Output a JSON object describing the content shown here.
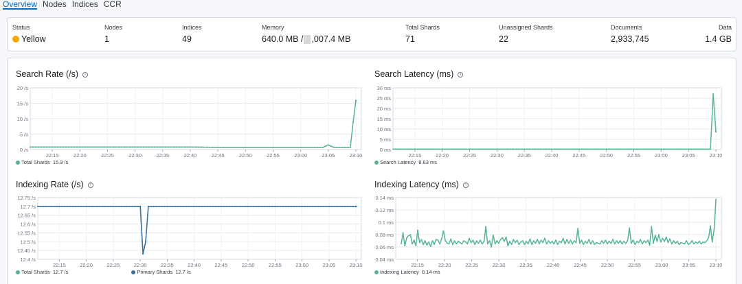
{
  "tabs": [
    {
      "label": "Overview",
      "active": true
    },
    {
      "label": "Nodes",
      "active": false
    },
    {
      "label": "Indices",
      "active": false
    },
    {
      "label": "CCR",
      "active": false
    }
  ],
  "summary": {
    "status": {
      "label": "Status",
      "value": "Yellow",
      "color": "#f5a700"
    },
    "nodes": {
      "label": "Nodes",
      "value": "1"
    },
    "indices": {
      "label": "Indices",
      "value": "49"
    },
    "memory": {
      "label": "Memory",
      "value_a": "640.0 MB /",
      "value_b": ",007.4 MB"
    },
    "total_shards": {
      "label": "Total Shards",
      "value": "71"
    },
    "unassigned_shards": {
      "label": "Unassigned Shards",
      "value": "22"
    },
    "documents": {
      "label": "Documents",
      "value": "2,933,745"
    },
    "data": {
      "label": "Data",
      "value": "1.4 GB"
    }
  },
  "colors": {
    "accent": "#006bb8",
    "teal": "#54b399",
    "blue": "#6092c0",
    "darkblue": "#3e6f9e"
  },
  "x_ticks": [
    "22:15",
    "22:20",
    "22:25",
    "22:30",
    "22:35",
    "22:40",
    "22:45",
    "22:50",
    "22:55",
    "23:00",
    "23:05",
    "23:10"
  ],
  "chart_data": [
    {
      "type": "line",
      "title": "Search Rate (/s)",
      "y_ticks": [
        "0 /s",
        "5 /s",
        "10 /s",
        "15 /s",
        "20 /s"
      ],
      "ylim": [
        0,
        20
      ],
      "x_range": [
        "22:11",
        "23:11"
      ],
      "series": [
        {
          "name": "Total Shards",
          "color": "#54b399",
          "legend_value": "15.9 /s",
          "points": [
            [
              "22:11",
              0.8
            ],
            [
              "22:40",
              0.8
            ],
            [
              "22:45",
              0.7
            ],
            [
              "23:04",
              0.7
            ],
            [
              "23:05",
              1.5
            ],
            [
              "23:06",
              0.7
            ],
            [
              "23:09",
              0.7
            ],
            [
              "23:09.5",
              8.8
            ],
            [
              "23:10",
              15.9
            ]
          ]
        }
      ]
    },
    {
      "type": "line",
      "title": "Search Latency (ms)",
      "y_ticks": [
        "0 ms",
        "5 ms",
        "10 ms",
        "15 ms",
        "20 ms",
        "25 ms",
        "30 ms"
      ],
      "ylim": [
        0,
        30
      ],
      "x_range": [
        "22:11",
        "23:11"
      ],
      "series": [
        {
          "name": "Search Latency",
          "color": "#54b399",
          "legend_value": "8.63 ms",
          "points": [
            [
              "22:11",
              0.2
            ],
            [
              "23:09",
              0.2
            ],
            [
              "23:09.5",
              27
            ],
            [
              "23:10",
              8.63
            ]
          ]
        }
      ]
    },
    {
      "type": "line",
      "title": "Indexing Rate (/s)",
      "y_ticks": [
        "12.4 /s",
        "12.45 /s",
        "12.5 /s",
        "12.55 /s",
        "12.6 /s",
        "12.65 /s",
        "12.7 /s",
        "12.75 /s"
      ],
      "ylim": [
        12.4,
        12.75
      ],
      "x_range": [
        "22:11",
        "23:11"
      ],
      "series": [
        {
          "name": "Total Shards",
          "color": "#54b399",
          "legend_value": "12.7 /s",
          "points": [
            [
              "22:11",
              12.7
            ],
            [
              "22:30",
              12.7
            ],
            [
              "22:30.5",
              12.43
            ],
            [
              "22:31",
              12.5
            ],
            [
              "22:31.5",
              12.7
            ],
            [
              "23:10",
              12.7
            ]
          ]
        },
        {
          "name": "Primary Shards",
          "color": "#3e6f9e",
          "legend_value": "12.7 /s",
          "points": [
            [
              "22:11",
              12.7
            ],
            [
              "22:30",
              12.7
            ],
            [
              "22:30.5",
              12.43
            ],
            [
              "22:31",
              12.5
            ],
            [
              "22:31.5",
              12.7
            ],
            [
              "23:10",
              12.7
            ]
          ]
        }
      ]
    },
    {
      "type": "line",
      "title": "Indexing Latency (ms)",
      "y_ticks": [
        "0.04 ms",
        "0.06 ms",
        "0.08 ms",
        "0.1 ms",
        "0.12 ms",
        "0.14 ms"
      ],
      "ylim": [
        0.04,
        0.14
      ],
      "x_range": [
        "22:11",
        "23:11"
      ],
      "series": [
        {
          "name": "Indexing Latency",
          "color": "#54b399",
          "legend_value": "0.14 ms",
          "values": [
            0.065,
            0.083,
            0.062,
            0.075,
            0.078,
            0.08,
            0.065,
            0.071,
            0.062,
            0.087,
            0.067,
            0.072,
            0.064,
            0.07,
            0.063,
            0.068,
            0.061,
            0.07,
            0.064,
            0.072,
            0.071,
            0.065,
            0.073,
            0.086,
            0.07,
            0.066,
            0.065,
            0.073,
            0.064,
            0.07,
            0.065,
            0.069,
            0.067,
            0.065,
            0.07,
            0.068,
            0.065,
            0.074,
            0.067,
            0.071,
            0.064,
            0.07,
            0.066,
            0.071,
            0.065,
            0.069,
            0.093,
            0.065,
            0.07,
            0.06,
            0.079,
            0.065,
            0.07,
            0.066,
            0.072,
            0.075,
            0.069,
            0.076,
            0.062,
            0.069,
            0.064,
            0.072,
            0.067,
            0.071,
            0.064,
            0.068,
            0.07,
            0.064,
            0.069,
            0.065,
            0.073,
            0.064,
            0.07,
            0.066,
            0.072,
            0.065,
            0.071,
            0.067,
            0.074,
            0.065,
            0.07,
            0.066,
            0.069,
            0.065,
            0.071,
            0.064,
            0.069,
            0.067,
            0.074,
            0.065,
            0.072,
            0.066,
            0.071,
            0.065,
            0.07,
            0.067,
            0.09,
            0.066,
            0.071,
            0.064,
            0.069,
            0.066,
            0.072,
            0.065,
            0.07,
            0.064,
            0.067,
            0.066,
            0.065,
            0.07,
            0.066,
            0.071,
            0.065,
            0.069,
            0.066,
            0.072,
            0.065,
            0.07,
            0.066,
            0.07,
            0.065,
            0.069,
            0.066,
            0.07,
            0.091,
            0.066,
            0.071,
            0.064,
            0.069,
            0.067,
            0.072,
            0.065,
            0.07,
            0.067,
            0.071,
            0.063,
            0.093,
            0.066,
            0.079,
            0.069,
            0.08,
            0.068,
            0.074,
            0.069,
            0.076,
            0.067,
            0.073,
            0.065,
            0.07,
            0.066,
            0.069,
            0.064,
            0.067,
            0.066,
            0.065,
            0.07,
            0.064,
            0.066,
            0.07,
            0.065,
            0.068,
            0.066,
            0.069,
            0.065,
            0.068,
            0.067,
            0.07,
            0.075,
            0.094,
            0.068,
            0.088,
            0.137
          ]
        }
      ]
    }
  ]
}
